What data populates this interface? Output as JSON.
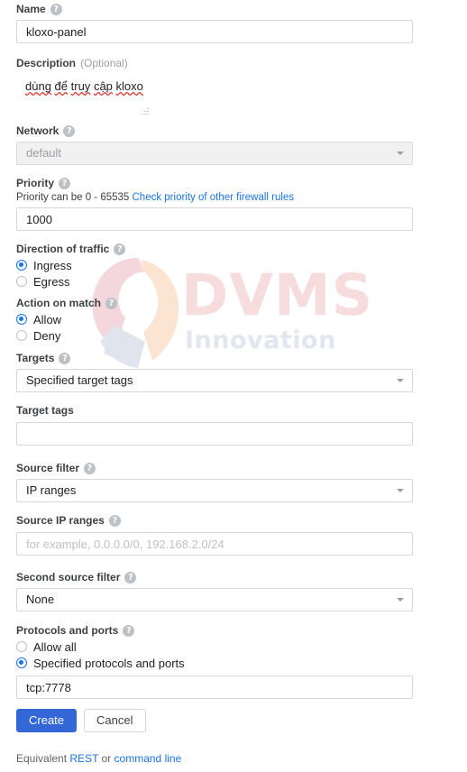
{
  "watermark": {
    "brand": "DVMS",
    "tagline": "Innovation",
    "brand_color": "#f6dcdc",
    "tagline_color": "#e2e6ee"
  },
  "icons": {
    "help": "?"
  },
  "form": {
    "name": {
      "label": "Name",
      "value": "kloxo-panel"
    },
    "description": {
      "label": "Description",
      "optional": "(Optional)",
      "value": "dùng để truy cập kloxo",
      "words": [
        "dùng",
        "để",
        "truy",
        "cập",
        "kloxo"
      ]
    },
    "network": {
      "label": "Network",
      "value": "default",
      "disabled": true
    },
    "priority": {
      "label": "Priority",
      "hint": "Priority can be 0 - 65535",
      "link": "Check priority of other firewall rules",
      "value": "1000"
    },
    "direction": {
      "label": "Direction of traffic",
      "options": [
        {
          "label": "Ingress",
          "selected": true
        },
        {
          "label": "Egress",
          "selected": false
        }
      ]
    },
    "action": {
      "label": "Action on match",
      "options": [
        {
          "label": "Allow",
          "selected": true
        },
        {
          "label": "Deny",
          "selected": false
        }
      ]
    },
    "targets": {
      "label": "Targets",
      "value": "Specified target tags"
    },
    "target_tags": {
      "label": "Target tags",
      "value": ""
    },
    "source_filter": {
      "label": "Source filter",
      "value": "IP ranges"
    },
    "source_ip_ranges": {
      "label": "Source IP ranges",
      "value": "",
      "placeholder": "for example, 0.0.0.0/0, 192.168.2.0/24"
    },
    "second_source_filter": {
      "label": "Second source filter",
      "value": "None"
    },
    "protocols": {
      "label": "Protocols and ports",
      "options": [
        {
          "label": "Allow all",
          "selected": false
        },
        {
          "label": "Specified protocols and ports",
          "selected": true
        }
      ],
      "value": "tcp:7778"
    }
  },
  "actions": {
    "create": "Create",
    "cancel": "Cancel"
  },
  "footer": {
    "prefix": "Equivalent",
    "rest_link": "REST",
    "middle": "or",
    "cmd_link": "command line"
  },
  "colors": {
    "accent": "#1a73e8",
    "primary_button": "#3367d6",
    "link": "#1a73e8",
    "spellcheck": "#e53935"
  }
}
